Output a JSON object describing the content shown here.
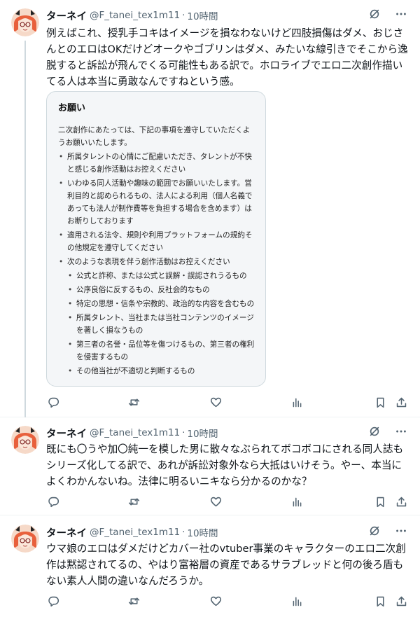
{
  "tweets": [
    {
      "author": {
        "name": "ターネイ",
        "handle": "@F_tanei_tex1m11"
      },
      "time": "10時間",
      "text": "例えばこれ、授乳手コキはイメージを損なわないけど四肢損傷はダメ、おじさんとのエロはOKだけどオークやゴブリンはダメ、みたいな線引きでそこから逸脱すると訴訟が飛んでくる可能性もある訳で。ホロライブでエロ二次創作描いてる人は本当に勇敢なんですねという感。",
      "card": {
        "title": "お願い",
        "intro": "二次創作にあたっては、下記の事項を遵守していただくようお願いいたします。",
        "items": [
          "所属タレントの心情にご配慮いただき、タレントが不快と感じる創作活動はお控えください",
          "いわゆる同人活動や趣味の範囲でお願いいたします。営利目的と認められるもの、法人による利用（個人名義であっても法人が制作費等を負担する場合を含めます）はお断りしております",
          "適用される法令、規則や利用プラットフォームの規約その他規定を遵守してください",
          "次のような表現を伴う創作活動はお控えください"
        ],
        "subitems": [
          "公式と詐称、または公式と誤解・誤認されうるもの",
          "公序良俗に反するもの、反社会的なもの",
          "特定の思想・信条や宗教的、政治的な内容を含むもの",
          "所属タレント、当社または当社コンテンツのイメージを著しく損なうもの",
          "第三者の名誉・品位等を傷つけるもの、第三者の権利を侵害するもの",
          "その他当社が不適切と判断するもの"
        ]
      }
    },
    {
      "author": {
        "name": "ターネイ",
        "handle": "@F_tanei_tex1m11"
      },
      "time": "10時間",
      "text": "既にも〇うや加〇純一を模した男に散々なぶられてボコボコにされる同人誌もシリーズ化してる訳で、あれが訴訟対象外なら大抵はいけそう。やー、本当によくわかんないね。法律に明るいニキなら分かるのかな？"
    },
    {
      "author": {
        "name": "ターネイ",
        "handle": "@F_tanei_tex1m11"
      },
      "time": "10時間",
      "text": "ウマ娘のエロはダメだけどカバー社のvtuber事業のキャラクターのエロ二次創作は黙認されてるの、やはり富裕層の資産であるサラブレッドと何の後ろ盾もない素人人間の違いなんだろうか。"
    }
  ],
  "separator": "·",
  "icons": {
    "avatar": "avatar-illustration",
    "grok": "grok-icon",
    "more": "more-options-icon",
    "reply": "reply-icon",
    "retweet": "retweet-icon",
    "like": "like-icon",
    "views": "views-icon",
    "bookmark": "bookmark-icon",
    "share": "share-icon"
  },
  "colors": {
    "text": "#0f1419",
    "secondary": "#536471",
    "border": "#eff3f4",
    "thread_line": "#cfd9de",
    "avatar_hair": "#e8603c"
  }
}
